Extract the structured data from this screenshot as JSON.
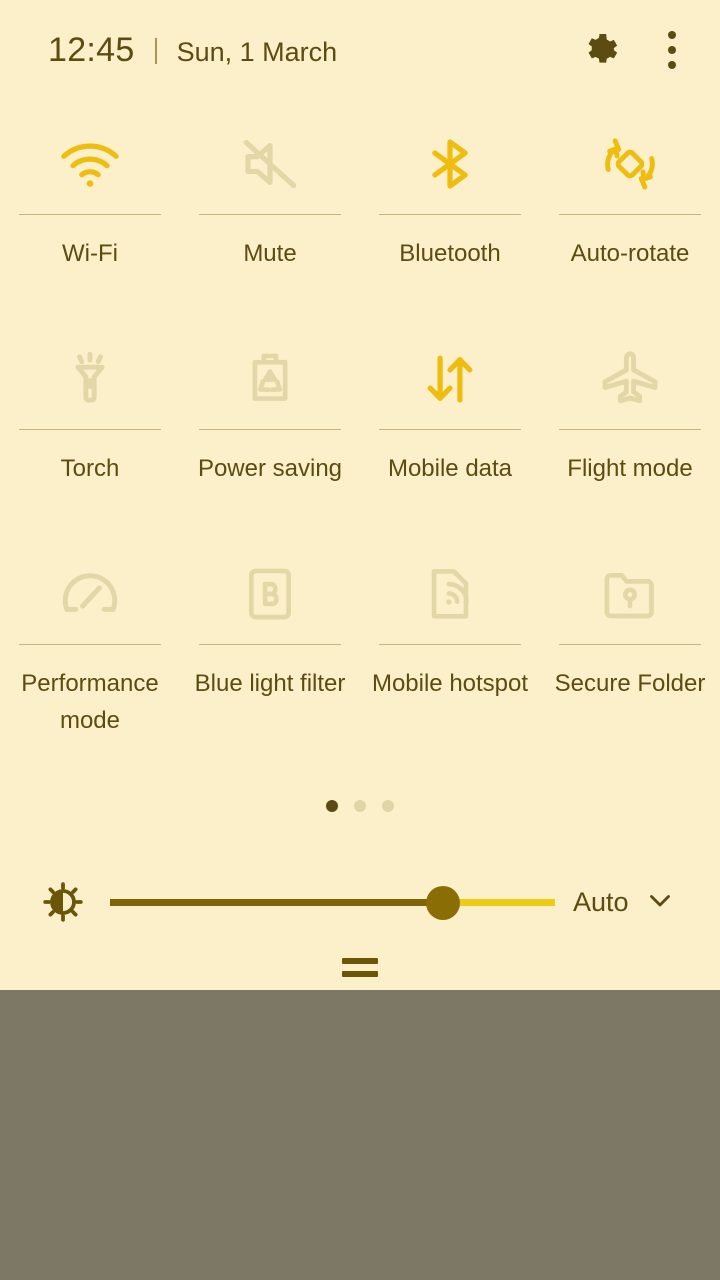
{
  "header": {
    "clock": "12:45",
    "separator": "|",
    "date": "Sun, 1 March",
    "settings_icon": "gear-icon",
    "overflow_icon": "more-vertical-icon"
  },
  "tiles": [
    {
      "label": "Wi-Fi",
      "icon": "wifi-icon",
      "state": "on"
    },
    {
      "label": "Mute",
      "icon": "volume-mute-icon",
      "state": "off"
    },
    {
      "label": "Bluetooth",
      "icon": "bluetooth-icon",
      "state": "on"
    },
    {
      "label": "Auto-rotate",
      "icon": "auto-rotate-icon",
      "state": "on"
    },
    {
      "label": "Torch",
      "icon": "flashlight-icon",
      "state": "off"
    },
    {
      "label": "Power saving",
      "icon": "battery-recycle-icon",
      "state": "off"
    },
    {
      "label": "Mobile data",
      "icon": "data-transfer-icon",
      "state": "on"
    },
    {
      "label": "Flight mode",
      "icon": "airplane-icon",
      "state": "off"
    },
    {
      "label": "Performance mode",
      "icon": "speedometer-icon",
      "state": "off"
    },
    {
      "label": "Blue light filter",
      "icon": "blue-light-icon",
      "state": "off"
    },
    {
      "label": "Mobile hotspot",
      "icon": "hotspot-icon",
      "state": "off"
    },
    {
      "label": "Secure Folder",
      "icon": "secure-folder-icon",
      "state": "off"
    }
  ],
  "pager": {
    "total_pages": 3,
    "current_page": 1
  },
  "brightness": {
    "icon": "brightness-icon",
    "value_percent": 75,
    "auto_label": "Auto",
    "chevron_icon": "chevron-down-icon"
  },
  "drag_handle": {
    "icon": "panel-drag-handle-icon"
  },
  "colors": {
    "panel_background": "#fcf0ca",
    "wallpaper": "#7d7765",
    "text": "#5d4c11",
    "active_accent": "#eebd10",
    "inactive_icon": "#e3d7a7",
    "divider": "#c7b482",
    "slider_track": "#eecb16",
    "slider_fill": "#7d6409",
    "slider_thumb": "#8a6e05"
  }
}
